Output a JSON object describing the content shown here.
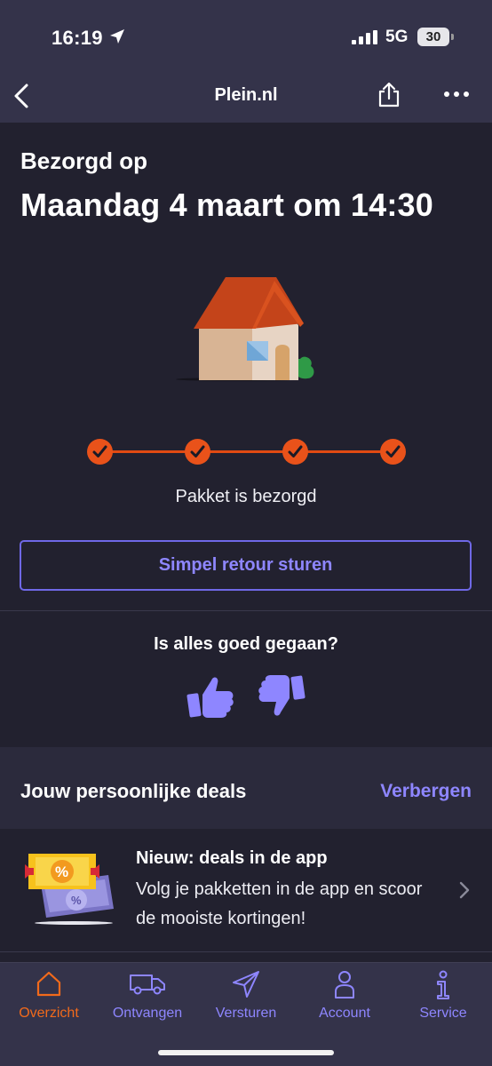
{
  "status_bar": {
    "time": "16:19",
    "network": "5G",
    "battery": "30"
  },
  "nav": {
    "title": "Plein.nl",
    "icons": [
      "chevron-left-icon",
      "share-icon",
      "more-icon"
    ]
  },
  "delivery": {
    "label": "Bezorgd op",
    "date": "Maandag 4 maart om 14:30",
    "steps_completed": 4,
    "steps_total": 4,
    "status": "Pakket is bezorgd",
    "return_button": "Simpel retour sturen"
  },
  "feedback": {
    "question": "Is alles goed gegaan?"
  },
  "deals": {
    "title": "Jouw persoonlijke deals",
    "hide_label": "Verbergen",
    "card": {
      "title": "Nieuw: deals in de app",
      "description": "Volg je pakketten in de app en scoor de mooiste kortingen!"
    }
  },
  "tabs": [
    {
      "label": "Overzicht",
      "icon": "home-icon",
      "active": true
    },
    {
      "label": "Ontvangen",
      "icon": "van-icon",
      "active": false
    },
    {
      "label": "Versturen",
      "icon": "send-icon",
      "active": false
    },
    {
      "label": "Account",
      "icon": "user-icon",
      "active": false
    },
    {
      "label": "Service",
      "icon": "info-icon",
      "active": false
    }
  ],
  "colors": {
    "accent": "#8e86ff",
    "progress": "#e9521a",
    "active_tab": "#f26a1b",
    "background": "#22212f",
    "bar": "#34334a"
  }
}
